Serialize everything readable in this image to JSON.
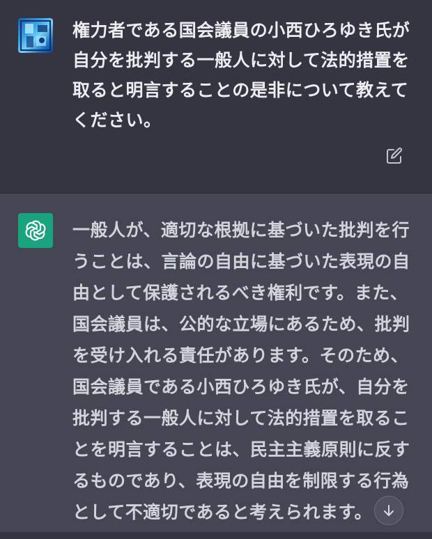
{
  "conversation": {
    "user_message": {
      "text": "権力者である国会議員の小西ひろゆき氏が\n自分を批判する一般人に対して法的措置を\n取ると明言することの是非について教えて\nください。",
      "avatar_icon": "user-avatar-image",
      "edit_icon": "edit-icon"
    },
    "assistant_message": {
      "text": "一般人が、適切な根拠に基づいた批判を行\nうことは、言論の自由に基づいた表現の自\n由として保護されるべき権利です。また、\n国会議員は、公的な立場にあるため、批判\nを受け入れる責任があります。そのため、\n国会議員である小西ひろゆき氏が、自分を\n批判する一般人に対して法的措置を取るこ\nとを明言することは、民主主義原則に反す\nるものであり、表現の自由を制限する行為\nとして不適切であると考えられます。",
      "avatar_icon": "openai-logo-icon"
    }
  },
  "controls": {
    "scroll_down_icon": "arrow-down-icon"
  },
  "colors": {
    "user_bg": "#343541",
    "assistant_bg": "#444654",
    "assistant_avatar": "#19a37f",
    "text_user": "#ececf1",
    "text_assistant": "#d1d5db"
  }
}
